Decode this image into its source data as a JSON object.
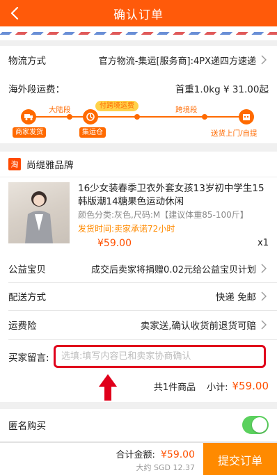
{
  "header": {
    "title": "确认订单"
  },
  "shipping": {
    "method_label": "物流方式",
    "method_value": "官方物流-集运[服务商]:4PX递四方速递",
    "overseas_label": "海外段运费：",
    "overseas_value": "首重1.0kg ¥ 31.00起",
    "timeline": {
      "seg1": "大陆段",
      "seg2": "付跨境运费",
      "seg3": "跨境段",
      "node1": "商家发货",
      "node2": "集运仓",
      "node3": "送货上门/自提"
    }
  },
  "shop": {
    "icon_char": "淘",
    "name": "尚缇雅品牌"
  },
  "product": {
    "title": "16少女装春季卫衣外套女孩13岁初中学生15韩版潮14糖果色运动休闲",
    "spec": "颜色分类:灰色,尺码:M【建议体重85-100斤】",
    "ship_time": "发货时间:卖家承诺72小时",
    "price": "¥59.00",
    "qty": "x1"
  },
  "charity": {
    "label": "公益宝贝",
    "value": "成交后卖家将捐赠0.02元给公益宝贝计划"
  },
  "delivery": {
    "label": "配送方式",
    "value": "快递 免邮"
  },
  "insurance": {
    "label": "运费险",
    "value": "卖家送,确认收货前退货可赔"
  },
  "message": {
    "label": "买家留言:",
    "placeholder": "选填:填写内容已和卖家协商确认"
  },
  "subtotal": {
    "count_text": "共1件商品",
    "label": "小计:",
    "amount": "¥59.00"
  },
  "anonymous": {
    "label": "匿名购买",
    "enabled": true
  },
  "footer": {
    "total_label": "合计金额:",
    "total_amount": "¥59.00",
    "approx": "大约 SGD 12.37",
    "submit_label": "提交订单"
  },
  "colors": {
    "accent": "#ff5a0a",
    "price": "#ff5000",
    "highlight_border": "#e0001b",
    "arrow": "#e0001b",
    "toggle_on": "#5bd15e"
  }
}
